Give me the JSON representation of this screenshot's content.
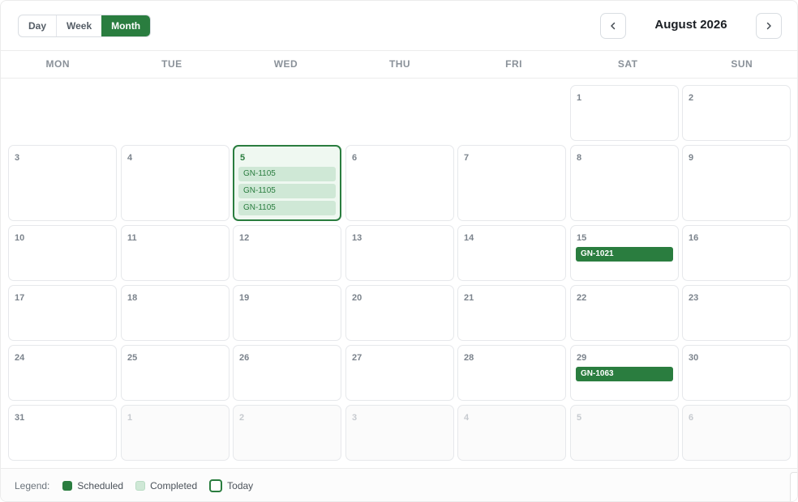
{
  "toolbar": {
    "views": [
      {
        "label": "Day",
        "active": false
      },
      {
        "label": "Week",
        "active": false
      },
      {
        "label": "Month",
        "active": true
      }
    ],
    "title": "August 2026",
    "prev_icon": "chevron-left-icon",
    "next_icon": "chevron-right-icon"
  },
  "weekdays": [
    "MON",
    "TUE",
    "WED",
    "THU",
    "FRI",
    "SAT",
    "SUN"
  ],
  "weeks": [
    [
      null,
      null,
      null,
      null,
      null,
      {
        "day": "1"
      },
      {
        "day": "2"
      }
    ],
    [
      {
        "day": "3"
      },
      {
        "day": "4"
      },
      {
        "day": "5",
        "today": true,
        "events": [
          {
            "label": "GN-1105",
            "status": "completed"
          },
          {
            "label": "GN-1105",
            "status": "completed"
          },
          {
            "label": "GN-1105",
            "status": "completed"
          }
        ]
      },
      {
        "day": "6"
      },
      {
        "day": "7"
      },
      {
        "day": "8"
      },
      {
        "day": "9"
      }
    ],
    [
      {
        "day": "10"
      },
      {
        "day": "11"
      },
      {
        "day": "12"
      },
      {
        "day": "13"
      },
      {
        "day": "14"
      },
      {
        "day": "15",
        "events": [
          {
            "label": "GN-1021",
            "status": "scheduled"
          }
        ]
      },
      {
        "day": "16"
      }
    ],
    [
      {
        "day": "17"
      },
      {
        "day": "18"
      },
      {
        "day": "19"
      },
      {
        "day": "20"
      },
      {
        "day": "21"
      },
      {
        "day": "22"
      },
      {
        "day": "23"
      }
    ],
    [
      {
        "day": "24"
      },
      {
        "day": "25"
      },
      {
        "day": "26"
      },
      {
        "day": "27"
      },
      {
        "day": "28"
      },
      {
        "day": "29",
        "events": [
          {
            "label": "GN-1063",
            "status": "scheduled"
          }
        ]
      },
      {
        "day": "30"
      }
    ],
    [
      {
        "day": "31"
      },
      {
        "day": "1",
        "outside": true
      },
      {
        "day": "2",
        "outside": true
      },
      {
        "day": "3",
        "outside": true
      },
      {
        "day": "4",
        "outside": true
      },
      {
        "day": "5",
        "outside": true
      },
      {
        "day": "6",
        "outside": true
      }
    ]
  ],
  "legend": {
    "label": "Legend:",
    "items": [
      {
        "key": "scheduled",
        "label": "Scheduled"
      },
      {
        "key": "completed",
        "label": "Completed"
      },
      {
        "key": "today",
        "label": "Today"
      }
    ]
  },
  "colors": {
    "accent": "#2a7d3f",
    "completed": "#cfe8d6"
  }
}
